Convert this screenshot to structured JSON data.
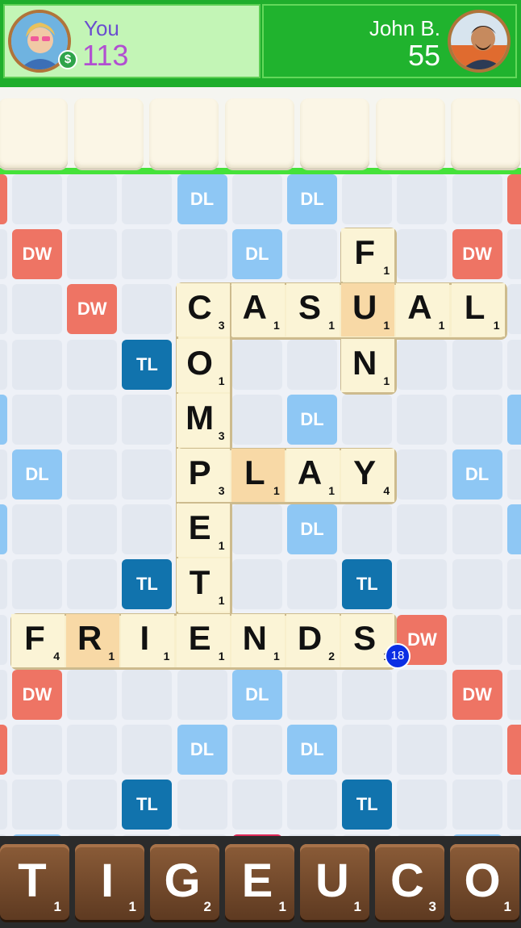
{
  "players": {
    "you": {
      "name": "You",
      "score": "113",
      "badge": "$"
    },
    "opponent": {
      "name": "John B.",
      "score": "55"
    }
  },
  "opponent_rack_slots": 7,
  "board": {
    "premium_squares": [
      {
        "label": "DL",
        "type": "DL",
        "col": 3,
        "row": 0
      },
      {
        "label": "DL",
        "type": "DL",
        "col": 5,
        "row": 0
      },
      {
        "label": "DW",
        "type": "DW",
        "col": 0,
        "row": 1
      },
      {
        "label": "DL",
        "type": "DL",
        "col": 4,
        "row": 1
      },
      {
        "label": "DW",
        "type": "DW",
        "col": 8,
        "row": 1
      },
      {
        "label": "DW",
        "type": "DW",
        "col": 1,
        "row": 2
      },
      {
        "label": "TL",
        "type": "TL",
        "col": 2,
        "row": 3
      },
      {
        "label": "DL",
        "type": "DL",
        "col": 5,
        "row": 4
      },
      {
        "label": "DL",
        "type": "DL",
        "col": 0,
        "row": 5
      },
      {
        "label": "DL",
        "type": "DL",
        "col": 8,
        "row": 5
      },
      {
        "label": "DL",
        "type": "DL",
        "col": 5,
        "row": 6
      },
      {
        "label": "TL",
        "type": "TL",
        "col": 2,
        "row": 7
      },
      {
        "label": "TL",
        "type": "TL",
        "col": 6,
        "row": 7
      },
      {
        "label": "DW",
        "type": "DW",
        "col": 7,
        "row": 8
      },
      {
        "label": "DW",
        "type": "DW",
        "col": 0,
        "row": 9
      },
      {
        "label": "DL",
        "type": "DL",
        "col": 4,
        "row": 9
      },
      {
        "label": "DW",
        "type": "DW",
        "col": 8,
        "row": 9
      },
      {
        "label": "DL",
        "type": "DL",
        "col": 3,
        "row": 10
      },
      {
        "label": "DL",
        "type": "DL",
        "col": 5,
        "row": 10
      },
      {
        "label": "TL",
        "type": "TL",
        "col": 2,
        "row": 11
      },
      {
        "label": "TL",
        "type": "TL",
        "col": 6,
        "row": 11
      }
    ],
    "edge_squares": [
      {
        "type": "DW",
        "col": -1,
        "row": 0
      },
      {
        "type": "DW",
        "col": 9,
        "row": 0
      },
      {
        "type": "DL",
        "col": -1,
        "row": 4
      },
      {
        "type": "DL",
        "col": 9,
        "row": 4
      },
      {
        "type": "DL",
        "col": -1,
        "row": 6
      },
      {
        "type": "DL",
        "col": 9,
        "row": 6
      },
      {
        "type": "DW",
        "col": -1,
        "row": 10
      },
      {
        "type": "DW",
        "col": 9,
        "row": 10
      },
      {
        "type": "TW",
        "col": 4,
        "row": 12
      },
      {
        "type": "DL",
        "col": 0,
        "row": 12
      },
      {
        "type": "DL",
        "col": 8,
        "row": 12
      }
    ],
    "words": [
      {
        "word": "FUN",
        "dir": "down",
        "col": 6,
        "row": 1,
        "tiles": [
          {
            "l": "F",
            "p": "1"
          },
          {
            "l": "U",
            "p": "1"
          },
          {
            "l": "N",
            "p": "1"
          }
        ]
      },
      {
        "word": "CASUAL",
        "dir": "across",
        "col": 3,
        "row": 2,
        "highlight": [
          3
        ],
        "tiles": [
          {
            "l": "C",
            "p": "3"
          },
          {
            "l": "A",
            "p": "1"
          },
          {
            "l": "S",
            "p": "1"
          },
          {
            "l": "U",
            "p": "1"
          },
          {
            "l": "A",
            "p": "1"
          },
          {
            "l": "L",
            "p": "1"
          }
        ]
      },
      {
        "word": "COMPETE",
        "dir": "down",
        "col": 3,
        "row": 2,
        "tiles": [
          {
            "l": "C",
            "p": "3"
          },
          {
            "l": "O",
            "p": "1"
          },
          {
            "l": "M",
            "p": "3"
          },
          {
            "l": "P",
            "p": "3"
          },
          {
            "l": "E",
            "p": "1"
          },
          {
            "l": "T",
            "p": "1"
          },
          {
            "l": "E",
            "p": "1"
          }
        ]
      },
      {
        "word": "PLAY",
        "dir": "across",
        "col": 3,
        "row": 5,
        "highlight": [
          1
        ],
        "tiles": [
          {
            "l": "P",
            "p": "3"
          },
          {
            "l": "L",
            "p": "1"
          },
          {
            "l": "A",
            "p": "1"
          },
          {
            "l": "Y",
            "p": "4"
          }
        ]
      },
      {
        "word": "FRIENDS",
        "dir": "across",
        "col": 0,
        "row": 8,
        "highlight": [
          1
        ],
        "tiles": [
          {
            "l": "F",
            "p": "4"
          },
          {
            "l": "R",
            "p": "1"
          },
          {
            "l": "I",
            "p": "1"
          },
          {
            "l": "E",
            "p": "1"
          },
          {
            "l": "N",
            "p": "1"
          },
          {
            "l": "D",
            "p": "2"
          },
          {
            "l": "S",
            "p": "1"
          }
        ]
      }
    ],
    "move_score": "18"
  },
  "player_rack": [
    {
      "letter": "T",
      "points": "1"
    },
    {
      "letter": "I",
      "points": "1"
    },
    {
      "letter": "G",
      "points": "2"
    },
    {
      "letter": "E",
      "points": "1"
    },
    {
      "letter": "U",
      "points": "1"
    },
    {
      "letter": "C",
      "points": "3"
    },
    {
      "letter": "O",
      "points": "1"
    }
  ],
  "colors": {
    "header_green": "#1fae2c",
    "dl": "#8ec7f4",
    "tl": "#1173ad",
    "dw": "#ee7464",
    "tw": "#de2a59",
    "tile": "#fbf4d6",
    "score_bubble": "#0b2ee4"
  }
}
